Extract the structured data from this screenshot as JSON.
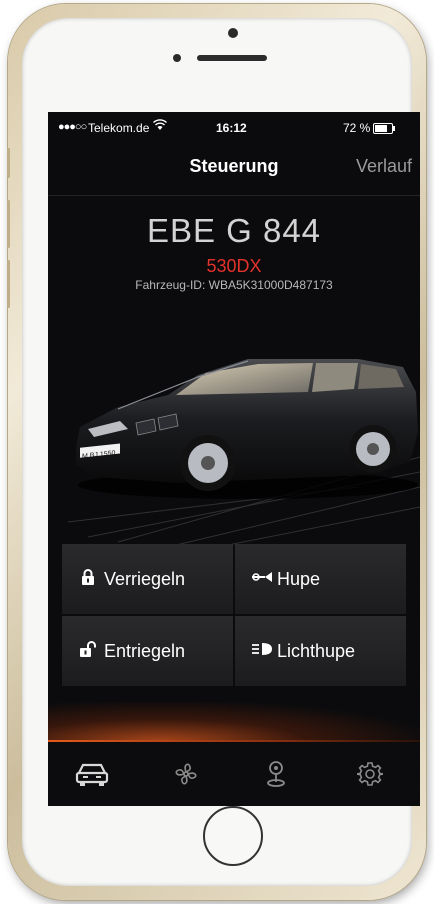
{
  "status_bar": {
    "signal": "●●●○○",
    "carrier": "Telekom.de",
    "time": "16:12",
    "battery": "72 %"
  },
  "nav": {
    "title": "Steuerung",
    "right_label": "Verlauf"
  },
  "vehicle": {
    "plate": "EBE G 844",
    "model": "530DX",
    "vehicle_id": "Fahrzeug-ID: WBA5K31000D487173",
    "license_plate_on_car": "M BJ 1550"
  },
  "controls": [
    {
      "label": "Verriegeln",
      "icon": "lock-icon"
    },
    {
      "label": "Hupe",
      "icon": "horn-icon"
    },
    {
      "label": "Entriegeln",
      "icon": "unlock-icon"
    },
    {
      "label": "Lichthupe",
      "icon": "headlight-flash-icon"
    }
  ],
  "tabs": [
    {
      "name": "vehicle",
      "icon": "car-icon",
      "active": true
    },
    {
      "name": "climate",
      "icon": "fan-icon",
      "active": false
    },
    {
      "name": "location",
      "icon": "map-pin-icon",
      "active": false
    },
    {
      "name": "settings",
      "icon": "gear-icon",
      "active": false
    }
  ],
  "colors": {
    "accent": "#e2322b",
    "glow": "#e35a1a",
    "background": "#0b0b0d"
  }
}
